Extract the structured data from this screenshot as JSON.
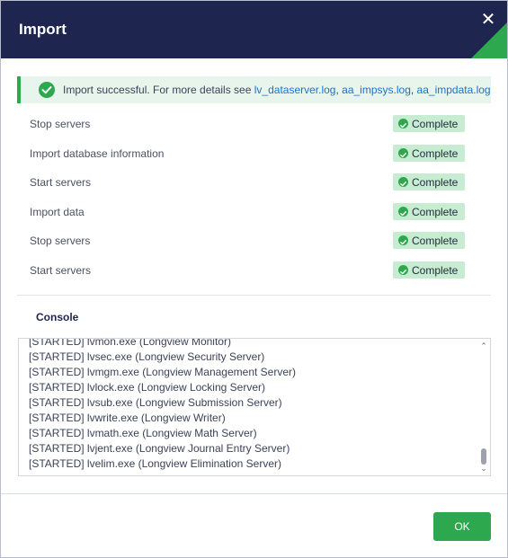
{
  "dialog": {
    "title": "Import",
    "close_glyph": "✕",
    "accent_color": "#2ea84f",
    "header_color": "#1e2650"
  },
  "banner": {
    "icon": "check-circle-icon",
    "message": "Import successful. For more details see ",
    "links": [
      "lv_dataserver.log",
      "aa_impsys.log",
      "aa_impdata.log"
    ],
    "separator": ", "
  },
  "steps": [
    {
      "label": "Stop servers",
      "status": "Complete"
    },
    {
      "label": "Import database information",
      "status": "Complete"
    },
    {
      "label": "Start servers",
      "status": "Complete"
    },
    {
      "label": "Import data",
      "status": "Complete"
    },
    {
      "label": "Stop servers",
      "status": "Complete"
    },
    {
      "label": "Start servers",
      "status": "Complete"
    }
  ],
  "console": {
    "title": "Console",
    "lines": [
      "[STARTED] lvmon.exe (Longview Monitor)",
      "[STARTED] lvsec.exe (Longview Security Server)",
      "[STARTED] lvmgm.exe (Longview Management Server)",
      "[STARTED] lvlock.exe (Longview Locking Server)",
      "[STARTED] lvsub.exe (Longview Submission Server)",
      "[STARTED] lvwrite.exe (Longview Writer)",
      "[STARTED] lvmath.exe (Longview Math Server)",
      "[STARTED] lvjent.exe (Longview Journal Entry Server)",
      "[STARTED] lvelim.exe (Longview Elimination Server)"
    ],
    "scroll_up_glyph": "⌃",
    "scroll_down_glyph": "⌄"
  },
  "footer": {
    "ok_label": "OK"
  }
}
